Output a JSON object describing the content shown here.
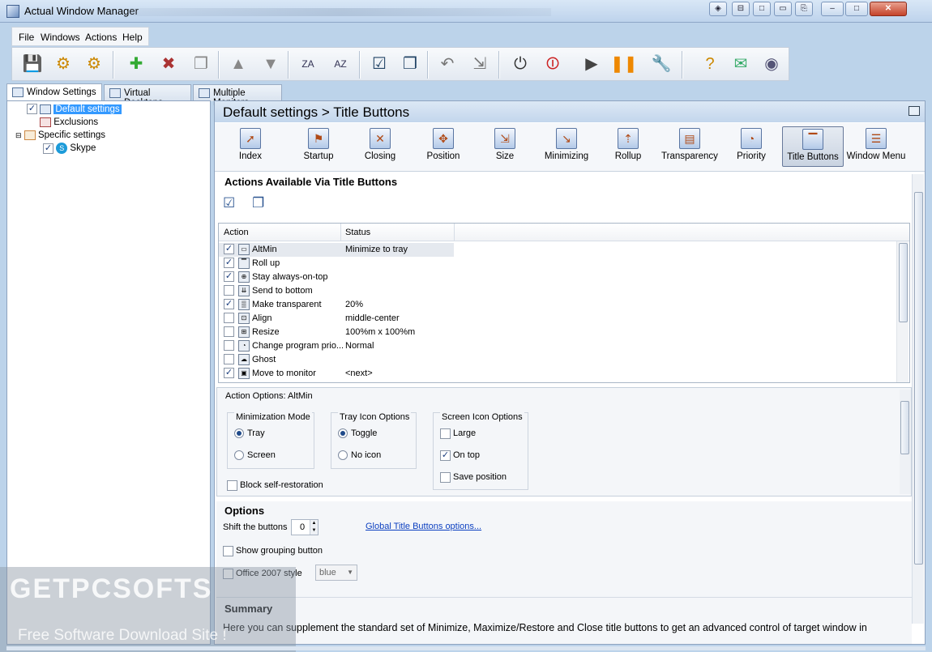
{
  "window": {
    "title": "Actual Window Manager",
    "caption_buttons": [
      "◈",
      "⊟",
      "□",
      "▭",
      "⎘",
      "–",
      "□",
      "✕"
    ]
  },
  "menubar": {
    "items": [
      "File",
      "Windows",
      "Actions",
      "Help"
    ]
  },
  "toolbar": {
    "icons": [
      "save-icon",
      "settings-icon",
      "settings-multi-icon",
      "new-item-icon",
      "delete-item-icon",
      "copy-icon",
      "move-up-icon",
      "move-down-icon",
      "sort-az-icon",
      "sort-za-icon",
      "check-all-icon",
      "uncheck-all-icon",
      "undo-icon",
      "redo-icon",
      "power-icon",
      "stop-icon",
      "play-icon",
      "pause-icon",
      "tools-icon",
      "help-icon",
      "mail-icon",
      "broadcast-icon"
    ]
  },
  "tabs": [
    "Window Settings",
    "Virtual Desktops",
    "Multiple Monitors"
  ],
  "tree": {
    "items": [
      "Default settings",
      "Exclusions",
      "Specific settings",
      "Skype"
    ]
  },
  "header": {
    "title": "Default settings > Title Buttons"
  },
  "categories": [
    "Index",
    "Startup",
    "Closing",
    "Position",
    "Size",
    "Minimizing",
    "Rollup",
    "Transparency",
    "Priority",
    "Title Buttons",
    "Window Menu"
  ],
  "actions": {
    "title": "Actions Available Via Title Buttons",
    "col_action": "Action",
    "col_status": "Status",
    "rows": [
      {
        "name": "AltMin",
        "status": "Minimize to tray",
        "checked": true
      },
      {
        "name": "Roll up",
        "status": "",
        "checked": true
      },
      {
        "name": "Stay always-on-top",
        "status": "",
        "checked": true
      },
      {
        "name": "Send to bottom",
        "status": "",
        "checked": false
      },
      {
        "name": "Make transparent",
        "status": "20%",
        "checked": true
      },
      {
        "name": "Align",
        "status": "middle-center",
        "checked": false
      },
      {
        "name": "Resize",
        "status": "100%m x 100%m",
        "checked": false
      },
      {
        "name": "Change program prio...",
        "status": "Normal",
        "checked": false
      },
      {
        "name": "Ghost",
        "status": "",
        "checked": false
      },
      {
        "name": "Move to monitor",
        "status": "<next>",
        "checked": true
      }
    ]
  },
  "action_options": {
    "title": "Action Options: AltMin",
    "minimization_mode": {
      "title": "Minimization Mode",
      "options": [
        "Tray",
        "Screen"
      ],
      "selected": "Tray"
    },
    "tray_icon": {
      "title": "Tray Icon Options",
      "options": [
        "Toggle",
        "No icon"
      ],
      "selected": "Toggle"
    },
    "screen_icon": {
      "title": "Screen Icon Options",
      "large": "Large",
      "on_top": "On top",
      "save_position": "Save position"
    },
    "block": "Block self-restoration"
  },
  "options": {
    "title": "Options",
    "shift_label": "Shift the buttons",
    "shift_value": "0",
    "global_link": "Global Title Buttons options...",
    "grouping": "Show grouping button",
    "office_style": "Office 2007 style",
    "style_value": "blue"
  },
  "summary": {
    "title": "Summary",
    "text": "Here you can supplement the standard set of Minimize, Maximize/Restore and Close title buttons to get an advanced control of target window in"
  },
  "watermark": {
    "logo": "GETPCSOFTS",
    "tagline": "Free Software Download Site !"
  }
}
